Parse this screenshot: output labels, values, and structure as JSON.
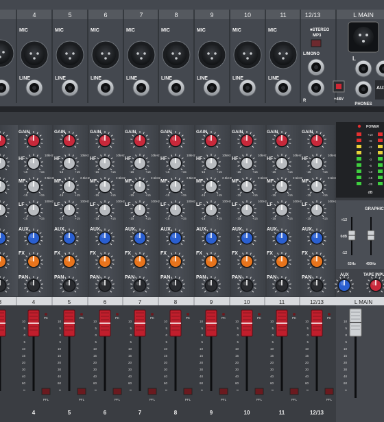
{
  "colors": {
    "panel": "#44484f",
    "panel_light": "#5a5f67",
    "strip_dark": "#2f3237",
    "gain_knob": "#c8283a",
    "eq_knob": "#b9bcc0",
    "aux_knob": "#2a5fd0",
    "fx_knob": "#e8741c",
    "pan_knob": "#2a2c30",
    "fader_cap": "#c01e2c",
    "main_fader_cap": "#d0d3d6",
    "led_green": "#3fcf3f",
    "led_yellow": "#e8d23a",
    "led_red": "#e33030"
  },
  "top": {
    "channels": [
      "4",
      "5",
      "6",
      "7",
      "8",
      "9",
      "10",
      "11"
    ],
    "stereo_channel": "12/13",
    "main_header": "L  MAIN",
    "mic_label": "MIC",
    "line_label": "LINE",
    "stereo_mp3": "■STEREO\nMP3",
    "lmono_label": "L/MONO",
    "r_label": "R",
    "phantom_label": "+48V",
    "phones_label": "PHONES",
    "aux_label": "AUX",
    "l_label": "L"
  },
  "strip": {
    "gain_label": "GAIN",
    "hf_label": "HF",
    "mf_label": "MF",
    "lf_label": "LF",
    "aux_label": "AUX",
    "fx_label": "FX",
    "pan_label": "PAN",
    "hf_freq": "10kHz",
    "mf_freq": "2.5kHz",
    "lf_freq": "100Hz",
    "minus15": "-15",
    "plus15": "+15",
    "pfl_label": "PFL",
    "pk_label": "PK"
  },
  "bottom_labels": [
    "3",
    "4",
    "5",
    "6",
    "7",
    "8",
    "9",
    "10",
    "11",
    "12/13"
  ],
  "master": {
    "power_label": "POWER",
    "meter_scale": [
      "+10",
      "+6",
      "+3",
      "0",
      "-3",
      "-6",
      "-10",
      "-15",
      "-20"
    ],
    "db_label": "dB",
    "graphic_eq_label": "GRAPHIC",
    "eq_scale": [
      "+12",
      "0dB",
      "-12"
    ],
    "eq_bands": [
      "63Hz",
      "400Hz"
    ],
    "aux_label": "AUX",
    "tape_input_label": "TAPE INPUT",
    "main_label": "L   MAIN"
  },
  "fader_scale": [
    "10",
    "5",
    "0",
    "5",
    "10",
    "15",
    "20",
    "30",
    "40",
    "60",
    "∞"
  ]
}
